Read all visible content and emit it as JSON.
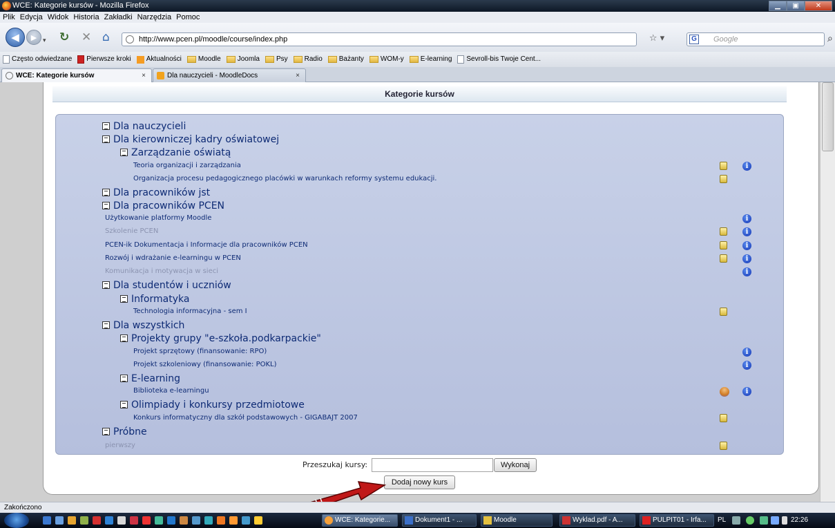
{
  "window": {
    "title": "WCE: Kategorie kursów - Mozilla Firefox"
  },
  "menu": [
    "Plik",
    "Edycja",
    "Widok",
    "Historia",
    "Zakładki",
    "Narzędzia",
    "Pomoc"
  ],
  "address": {
    "url": "http://www.pcen.pl/moodle/course/index.php",
    "search_placeholder": "Google"
  },
  "bookmarks": [
    "Często odwiedzane",
    "Pierwsze kroki",
    "Aktualności",
    "Moodle",
    "Joomla",
    "Psy",
    "Radio",
    "Bażanty",
    "WOM-y",
    "E-learning",
    "Sevroll-bis Twoje Cent..."
  ],
  "tabs": [
    {
      "label": "WCE: Kategorie kursów"
    },
    {
      "label": "Dla nauczycieli - MoodleDocs"
    }
  ],
  "page": {
    "header": "Kategorie kursów",
    "rows": [
      {
        "kind": "cat",
        "level": 0,
        "label": "Dla nauczycieli"
      },
      {
        "kind": "cat",
        "level": 0,
        "label": "Dla kierowniczej kadry oświatowej"
      },
      {
        "kind": "cat",
        "level": 1,
        "label": "Zarządzanie oświatą"
      },
      {
        "kind": "course",
        "level": 1,
        "label": "Teoria organizacji i zarządzania",
        "icons": [
          "key",
          "info"
        ]
      },
      {
        "kind": "course",
        "level": 1,
        "label": "Organizacja procesu pedagogicznego placówki w warunkach reformy systemu edukacji.",
        "icons": [
          "key"
        ]
      },
      {
        "kind": "cat",
        "level": 0,
        "label": "Dla pracowników jst"
      },
      {
        "kind": "cat",
        "level": 0,
        "label": "Dla pracowników PCEN"
      },
      {
        "kind": "course",
        "level": 0,
        "label": "Użytkowanie platformy Moodle",
        "icons": [
          "info"
        ]
      },
      {
        "kind": "course",
        "level": 0,
        "label": "Szkolenie PCEN",
        "dim": true,
        "icons": [
          "key",
          "info"
        ]
      },
      {
        "kind": "course",
        "level": 0,
        "label": "PCEN-ik Dokumentacja i Informacje dla pracowników PCEN",
        "icons": [
          "key",
          "info"
        ]
      },
      {
        "kind": "course",
        "level": 0,
        "label": "Rozwój i wdrażanie e-learningu w PCEN",
        "icons": [
          "key",
          "info"
        ]
      },
      {
        "kind": "course",
        "level": 0,
        "label": "Komunikacja i motywacja w sieci",
        "dim": true,
        "icons": [
          "info"
        ]
      },
      {
        "kind": "cat",
        "level": 0,
        "label": "Dla studentów i uczniów"
      },
      {
        "kind": "cat",
        "level": 1,
        "label": "Informatyka"
      },
      {
        "kind": "course",
        "level": 1,
        "label": "Technologia informacyjna - sem I",
        "icons": [
          "key"
        ]
      },
      {
        "kind": "cat",
        "level": 0,
        "label": "Dla wszystkich"
      },
      {
        "kind": "cat",
        "level": 1,
        "label": "Projekty grupy \"e-szkoła.podkarpackie\""
      },
      {
        "kind": "course",
        "level": 1,
        "label": "Projekt sprzętowy (finansowanie: RPO)",
        "icons": [
          "info"
        ]
      },
      {
        "kind": "course",
        "level": 1,
        "label": "Projekt szkoleniowy (finansowanie: POKL)",
        "icons": [
          "info"
        ]
      },
      {
        "kind": "cat",
        "level": 1,
        "label": "E-learning"
      },
      {
        "kind": "course",
        "level": 1,
        "label": "Biblioteka e-learningu",
        "icons": [
          "guest",
          "info"
        ]
      },
      {
        "kind": "cat",
        "level": 1,
        "label": "Olimpiady i konkursy przedmiotowe"
      },
      {
        "kind": "course",
        "level": 1,
        "label": "Konkurs informatyczny dla szkół podstawowych - GIGABAJT 2007",
        "icons": [
          "key"
        ]
      },
      {
        "kind": "cat",
        "level": 0,
        "label": "Próbne"
      },
      {
        "kind": "course",
        "level": 0,
        "label": "pierwszy",
        "dim": true,
        "icons": [
          "key"
        ]
      }
    ],
    "search_label": "Przeszukaj kursy:",
    "search_value": "",
    "search_button": "Wykonaj",
    "add_course_button": "Dodaj nowy kurs"
  },
  "status": "Zakończono",
  "taskbar": {
    "tasks": [
      "WCE: Kategorie...",
      "Dokument1 - ...",
      "Moodle",
      "Wyklad.pdf - A...",
      "PULPIT01 - Irfa..."
    ],
    "lang": "PL",
    "clock": "22:26"
  },
  "colors": {
    "link": "#0d2a74",
    "dim_link": "#8b93b0",
    "category_bg": "#c8d1e8",
    "arrow": "#c01818"
  }
}
